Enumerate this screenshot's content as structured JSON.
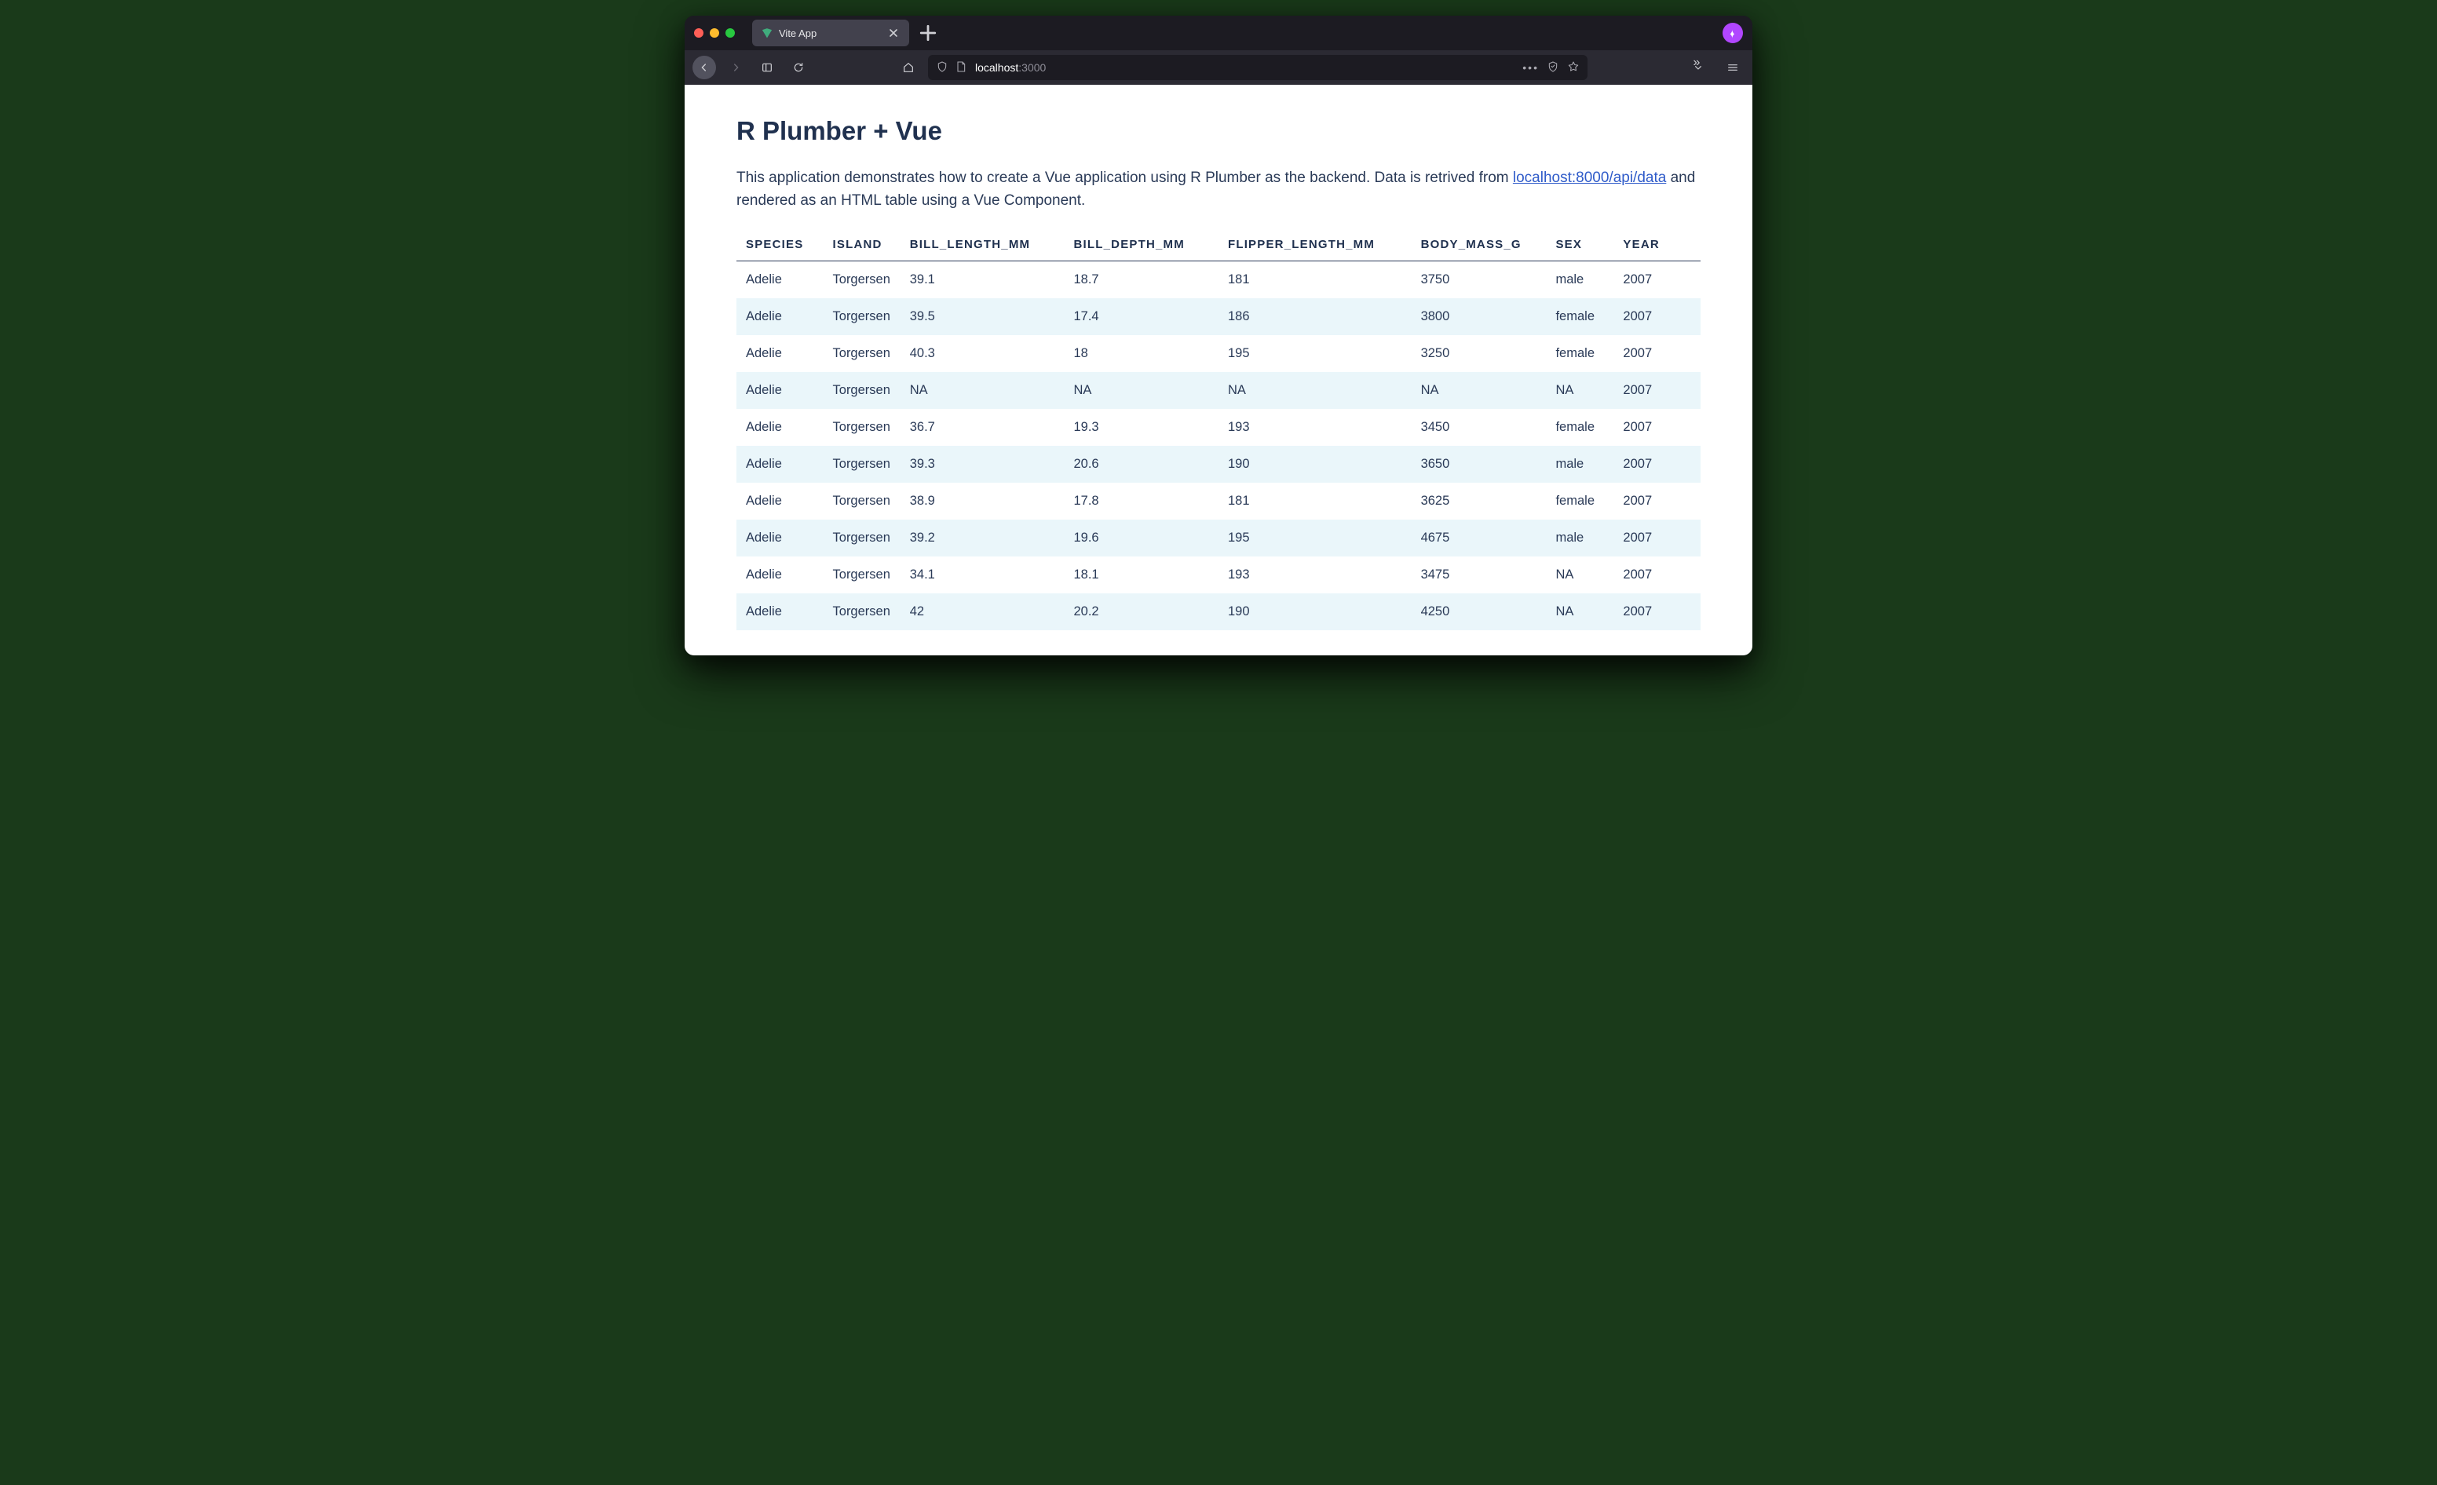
{
  "browser": {
    "tab_title": "Vite App",
    "url_host": "localhost",
    "url_port": ":3000"
  },
  "page": {
    "heading": "R Plumber + Vue",
    "lead_before": "This application demonstrates how to create a Vue application using R Plumber as the backend. Data is retrived from ",
    "lead_link_text": "localhost:8000/api/data",
    "lead_after": " and rendered as an HTML table using a Vue Component."
  },
  "table": {
    "headers": [
      "SPECIES",
      "ISLAND",
      "BILL_LENGTH_MM",
      "BILL_DEPTH_MM",
      "FLIPPER_LENGTH_MM",
      "BODY_MASS_G",
      "SEX",
      "YEAR"
    ],
    "rows": [
      [
        "Adelie",
        "Torgersen",
        "39.1",
        "18.7",
        "181",
        "3750",
        "male",
        "2007"
      ],
      [
        "Adelie",
        "Torgersen",
        "39.5",
        "17.4",
        "186",
        "3800",
        "female",
        "2007"
      ],
      [
        "Adelie",
        "Torgersen",
        "40.3",
        "18",
        "195",
        "3250",
        "female",
        "2007"
      ],
      [
        "Adelie",
        "Torgersen",
        "NA",
        "NA",
        "NA",
        "NA",
        "NA",
        "2007"
      ],
      [
        "Adelie",
        "Torgersen",
        "36.7",
        "19.3",
        "193",
        "3450",
        "female",
        "2007"
      ],
      [
        "Adelie",
        "Torgersen",
        "39.3",
        "20.6",
        "190",
        "3650",
        "male",
        "2007"
      ],
      [
        "Adelie",
        "Torgersen",
        "38.9",
        "17.8",
        "181",
        "3625",
        "female",
        "2007"
      ],
      [
        "Adelie",
        "Torgersen",
        "39.2",
        "19.6",
        "195",
        "4675",
        "male",
        "2007"
      ],
      [
        "Adelie",
        "Torgersen",
        "34.1",
        "18.1",
        "193",
        "3475",
        "NA",
        "2007"
      ],
      [
        "Adelie",
        "Torgersen",
        "42",
        "20.2",
        "190",
        "4250",
        "NA",
        "2007"
      ]
    ]
  }
}
